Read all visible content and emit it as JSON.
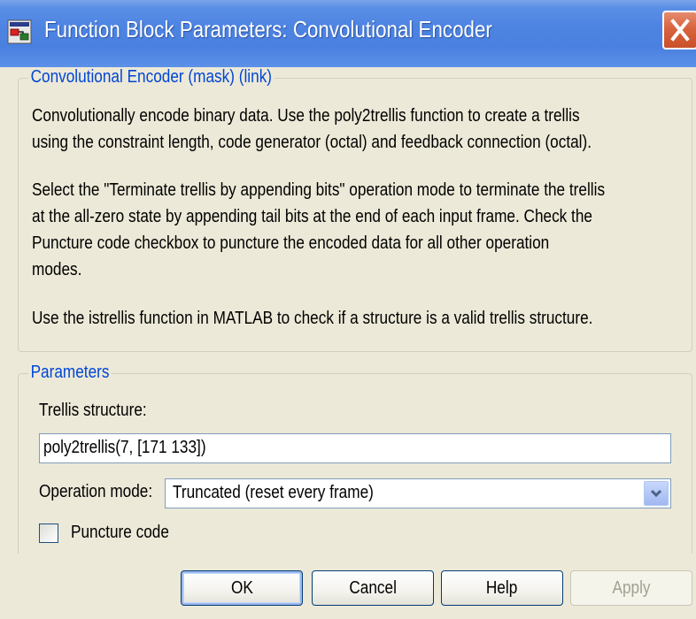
{
  "window": {
    "title": "Function Block Parameters: Convolutional Encoder"
  },
  "description": {
    "legend": "Convolutional Encoder (mask) (link)",
    "paragraph1": "Convolutionally encode binary data.  Use the poly2trellis function to create a trellis\nusing the constraint length, code generator (octal) and feedback connection (octal).",
    "paragraph2": "Select the \"Terminate trellis by appending bits\" operation mode to terminate the trellis\nat the all-zero state by appending tail bits at the end of each input frame.  Check the\nPuncture code checkbox to puncture the encoded data for all other operation\nmodes.",
    "paragraph3": "Use the istrellis function in MATLAB to check if a structure is a valid trellis structure."
  },
  "parameters": {
    "legend": "Parameters",
    "trellis_label": "Trellis structure:",
    "trellis_value": "poly2trellis(7, [171 133])",
    "operation_mode_label": "Operation mode:",
    "operation_mode_value": "Truncated (reset every frame)",
    "puncture_label": "Puncture code",
    "puncture_checked": false
  },
  "buttons": {
    "ok": "OK",
    "cancel": "Cancel",
    "help": "Help",
    "apply": "Apply"
  },
  "colors": {
    "title_bar": "#4a80df",
    "legend_text": "#0046d5",
    "close_button": "#d8643d",
    "dialog_background": "#ece9d8"
  },
  "icons": {
    "title": "simulink-block-icon",
    "close": "close-icon",
    "dropdown": "chevron-down-icon"
  }
}
